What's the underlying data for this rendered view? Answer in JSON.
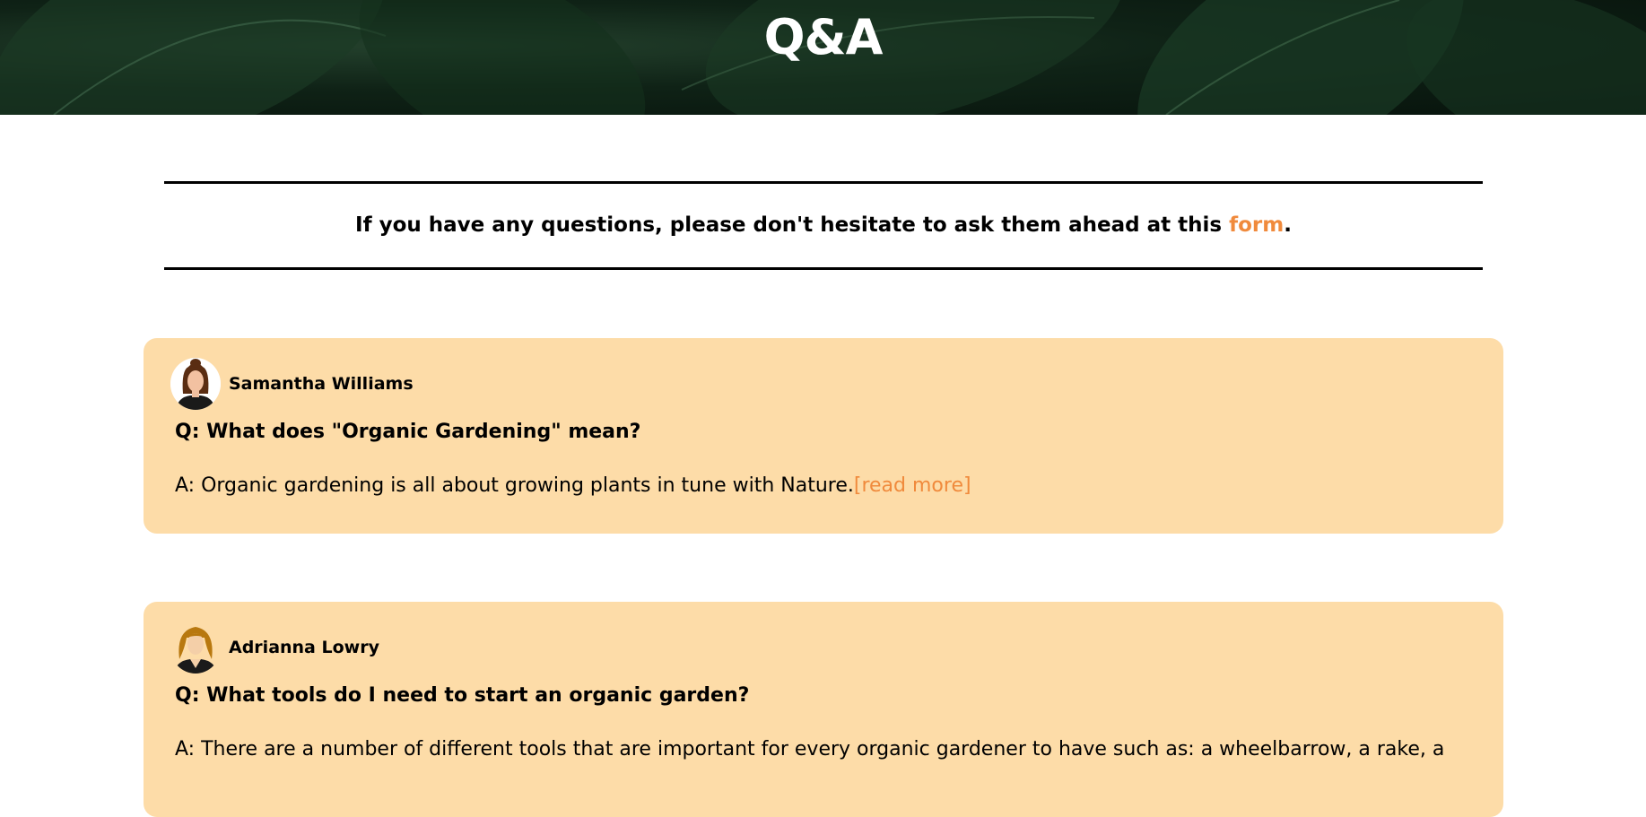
{
  "header": {
    "title": "Q&A"
  },
  "notice": {
    "text_before": "If you have any questions, please don't hesitate to ask them ahead at this ",
    "link_text": "form",
    "text_after": "."
  },
  "colors": {
    "accent": "#f08a3c",
    "card_background": "#fddca8",
    "hero_background": "#0f2216"
  },
  "qa": [
    {
      "author": "Samantha Williams",
      "avatar_icon": "woman-avatar-icon",
      "question": "Q: What does \"Organic Gardening\" mean?",
      "answer": "A: Organic gardening is all about growing plants in tune with Nature.",
      "read_more": "[read more]"
    },
    {
      "author": "Adrianna Lowry",
      "avatar_icon": "woman-blonde-avatar-icon",
      "question": "Q: What tools do I need to start an organic garden?",
      "answer": "A: There are a number of different tools that are important for every organic gardener to have such as: a wheelbarrow, a rake, a"
    }
  ]
}
